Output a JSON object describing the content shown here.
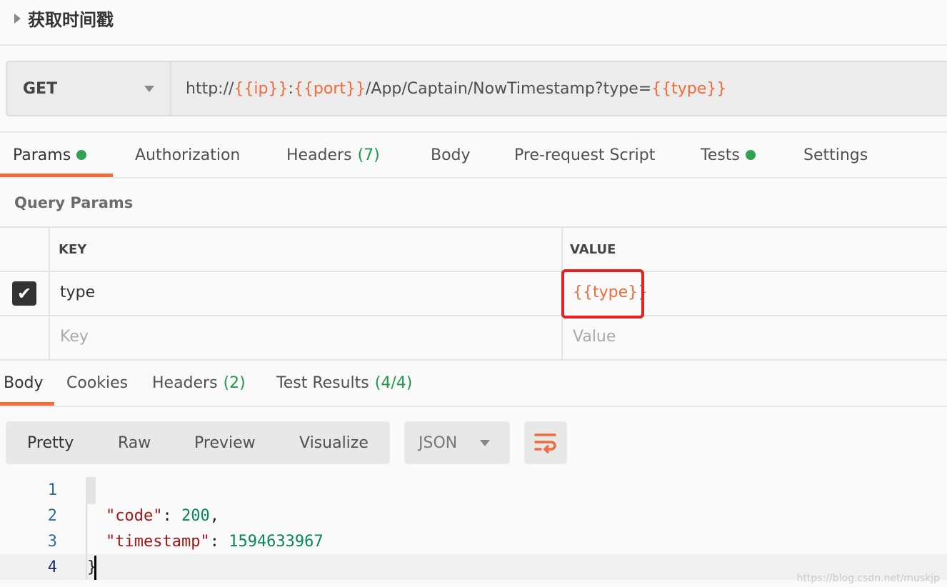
{
  "request": {
    "name": "获取时间戳",
    "method": "GET",
    "url_parts": [
      {
        "text": "http://",
        "var": false
      },
      {
        "text": "{{ip}}",
        "var": true
      },
      {
        "text": ":",
        "var": false
      },
      {
        "text": "{{port}}",
        "var": true
      },
      {
        "text": "/App/Captain/NowTimestamp?type=",
        "var": false
      },
      {
        "text": "{{type}}",
        "var": true
      }
    ]
  },
  "request_tabs": [
    {
      "label": "Params",
      "dot": true,
      "active": true
    },
    {
      "label": "Authorization"
    },
    {
      "label": "Headers",
      "count": "(7)"
    },
    {
      "label": "Body"
    },
    {
      "label": "Pre-request Script"
    },
    {
      "label": "Tests",
      "dot": true
    },
    {
      "label": "Settings"
    }
  ],
  "query_params": {
    "title": "Query Params",
    "headers": {
      "key": "KEY",
      "value": "VALUE"
    },
    "rows": [
      {
        "checked": true,
        "key": "type",
        "value": "{{type}}"
      }
    ],
    "placeholder": {
      "key": "Key",
      "value": "Value"
    }
  },
  "response_tabs": [
    {
      "label": "Body",
      "active": true
    },
    {
      "label": "Cookies"
    },
    {
      "label": "Headers",
      "count": "(2)"
    },
    {
      "label": "Test Results",
      "count": "(4/4)"
    }
  ],
  "view_modes": [
    "Pretty",
    "Raw",
    "Preview",
    "Visualize"
  ],
  "format": "JSON",
  "code_lines": [
    {
      "n": "1",
      "text": "{"
    },
    {
      "n": "2",
      "key": "\"code\"",
      "value": "200",
      "trail": ","
    },
    {
      "n": "3",
      "key": "\"timestamp\"",
      "value": "1594633967",
      "trail": ""
    },
    {
      "n": "4",
      "text": "}"
    }
  ],
  "watermark": "https://blog.csdn.net/muskjp",
  "colors": {
    "accent": "#f26b3a",
    "success": "#2fa352",
    "highlight": "#e8201f"
  }
}
